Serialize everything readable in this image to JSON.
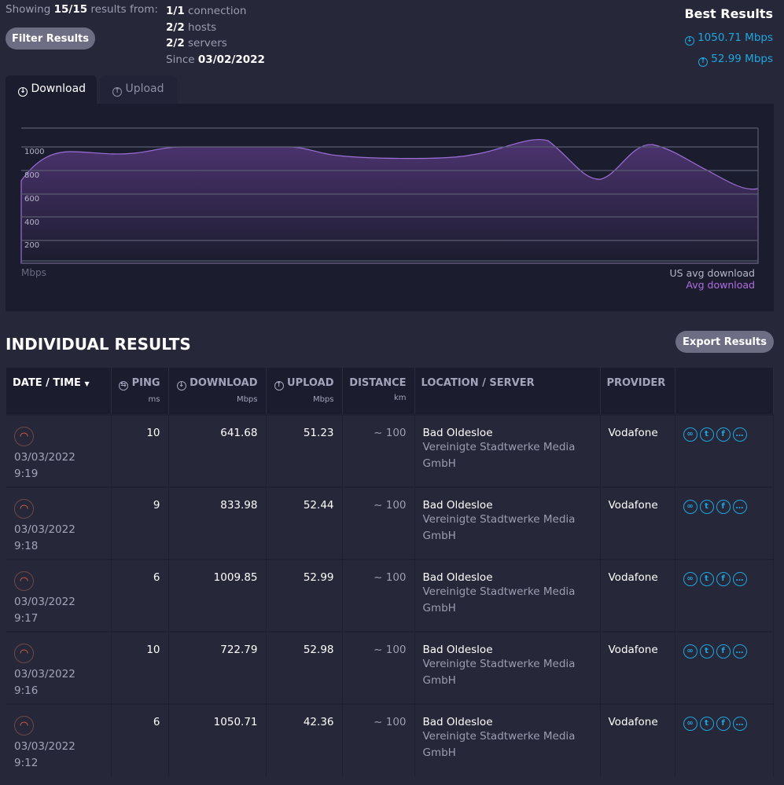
{
  "summary": {
    "showing_prefix": "Showing",
    "showing_count": "15/15",
    "showing_suffix": "results from:",
    "filter_label": "Filter Results",
    "connections_count": "1/1",
    "connections_label": "connection",
    "hosts_count": "2/2",
    "hosts_label": "hosts",
    "servers_count": "2/2",
    "servers_label": "servers",
    "since_label": "Since",
    "since_date": "03/02/2022"
  },
  "best": {
    "title": "Best Results",
    "download": "1050.71 Mbps",
    "upload": "52.99 Mbps"
  },
  "tabs": [
    {
      "label": "Download",
      "active": true
    },
    {
      "label": "Upload",
      "active": false
    }
  ],
  "chart": {
    "y_ticks": [
      "1000",
      "800",
      "600",
      "400",
      "200"
    ],
    "unit": "Mbps",
    "legend_us": "US avg download",
    "legend_avg": "Avg download",
    "accent": "#b06ee0"
  },
  "results": {
    "title": "INDIVIDUAL RESULTS",
    "export_label": "Export Results",
    "columns": [
      {
        "label": "DATE / TIME",
        "unit": ""
      },
      {
        "label": "PING",
        "unit": "ms"
      },
      {
        "label": "DOWNLOAD",
        "unit": "Mbps"
      },
      {
        "label": "UPLOAD",
        "unit": "Mbps"
      },
      {
        "label": "DISTANCE",
        "unit": "km"
      },
      {
        "label": "LOCATION / SERVER",
        "unit": ""
      },
      {
        "label": "PROVIDER",
        "unit": ""
      }
    ],
    "rows": [
      {
        "date": "03/03/2022",
        "time": "9:19",
        "ping": "10",
        "download": "641.68",
        "upload": "51.23",
        "distance": "~ 100",
        "location": "Bad Oldesloe",
        "server": "Vereinigte Stadtwerke Media GmbH",
        "provider": "Vodafone"
      },
      {
        "date": "03/03/2022",
        "time": "9:18",
        "ping": "9",
        "download": "833.98",
        "upload": "52.44",
        "distance": "~ 100",
        "location": "Bad Oldesloe",
        "server": "Vereinigte Stadtwerke Media GmbH",
        "provider": "Vodafone"
      },
      {
        "date": "03/03/2022",
        "time": "9:17",
        "ping": "6",
        "download": "1009.85",
        "upload": "52.99",
        "distance": "~ 100",
        "location": "Bad Oldesloe",
        "server": "Vereinigte Stadtwerke Media GmbH",
        "provider": "Vodafone"
      },
      {
        "date": "03/03/2022",
        "time": "9:16",
        "ping": "10",
        "download": "722.79",
        "upload": "52.98",
        "distance": "~ 100",
        "location": "Bad Oldesloe",
        "server": "Vereinigte Stadtwerke Media GmbH",
        "provider": "Vodafone"
      },
      {
        "date": "03/03/2022",
        "time": "9:12",
        "ping": "6",
        "download": "1050.71",
        "upload": "42.36",
        "distance": "~ 100",
        "location": "Bad Oldesloe",
        "server": "Vereinigte Stadtwerke Media GmbH",
        "provider": "Vodafone"
      }
    ]
  }
}
